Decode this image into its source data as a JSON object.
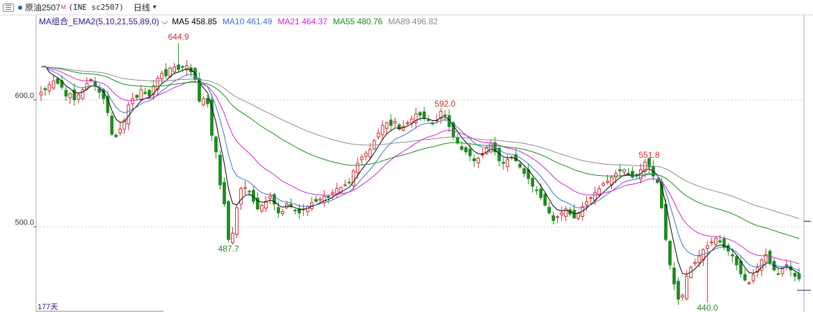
{
  "header": {
    "symbol_name": "原油2507",
    "symbol_sup": "M",
    "symbol_code": "(INE sc2507)",
    "period": "日线"
  },
  "indicator": {
    "name": "MA组合_EMA2(5,10,21,55,89,0)",
    "lines": [
      {
        "label": "MA5 458.85",
        "color": "#000000"
      },
      {
        "label": "MA10 461.49",
        "color": "#3a6fd0"
      },
      {
        "label": "MA21 464.37",
        "color": "#d21fd2"
      },
      {
        "label": "MA55 480.76",
        "color": "#138c13"
      },
      {
        "label": "MA89 496.82",
        "color": "#8a8a8a"
      }
    ]
  },
  "footer": {
    "count": "177天"
  },
  "chart_data": {
    "type": "candlestick",
    "ylim": [
      440,
      659
    ],
    "yticks": [
      "500.0",
      "600.0"
    ],
    "colors": {
      "up": "#d12a2a",
      "down": "#1e8a1e",
      "grid": "#c8c8c8"
    },
    "annotations": [
      {
        "text": "644.9",
        "index": 33,
        "value": 644.9,
        "position": "above",
        "color": "#d12a2a"
      },
      {
        "text": "487.7",
        "index": 45,
        "value": 487.7,
        "position": "below",
        "color": "#1e8a1e"
      },
      {
        "text": "592.0",
        "index": 97,
        "value": 592.0,
        "position": "above",
        "color": "#d12a2a"
      },
      {
        "text": "551.8",
        "index": 146,
        "value": 551.8,
        "position": "above",
        "color": "#d12a2a"
      },
      {
        "text": "440.0",
        "index": 160,
        "value": 440.0,
        "position": "below",
        "color": "#1e8a1e"
      }
    ],
    "closes": [
      606,
      608,
      612,
      615,
      613,
      610,
      603,
      605,
      600,
      604,
      608,
      613,
      616,
      611,
      606,
      601,
      590,
      573,
      571,
      577,
      584,
      596,
      601,
      602,
      608,
      605,
      603,
      611,
      617,
      621,
      619,
      625,
      626,
      624,
      626,
      627,
      622,
      616,
      599,
      601,
      597,
      572,
      559,
      533,
      518,
      490,
      495,
      515,
      530,
      531,
      528,
      520,
      514,
      517,
      520,
      524,
      518,
      511,
      512,
      518,
      516,
      513,
      511,
      514,
      516,
      519,
      520,
      522,
      524,
      523,
      527,
      530,
      531,
      533,
      535,
      544,
      550,
      555,
      558,
      561,
      568,
      574,
      580,
      582,
      580,
      583,
      577,
      579,
      582,
      585,
      589,
      588,
      586,
      584,
      581,
      584,
      591,
      588,
      579,
      571,
      566,
      561,
      559,
      556,
      552,
      554,
      557,
      562,
      566,
      559,
      552,
      550,
      553,
      555,
      552,
      547,
      542,
      538,
      532,
      529,
      523,
      517,
      511,
      505,
      508,
      511,
      514,
      510,
      507,
      511,
      516,
      520,
      523,
      527,
      530,
      534,
      536,
      539,
      542,
      544,
      545,
      542,
      539,
      540,
      545,
      551,
      547,
      540,
      535,
      515,
      490,
      470,
      455,
      443,
      446,
      461,
      468,
      472,
      477,
      482,
      485,
      488,
      491,
      488,
      484,
      481,
      477,
      470,
      463,
      458,
      456,
      462,
      468,
      474,
      478,
      472,
      466,
      463,
      467,
      470,
      466,
      461,
      459
    ]
  }
}
